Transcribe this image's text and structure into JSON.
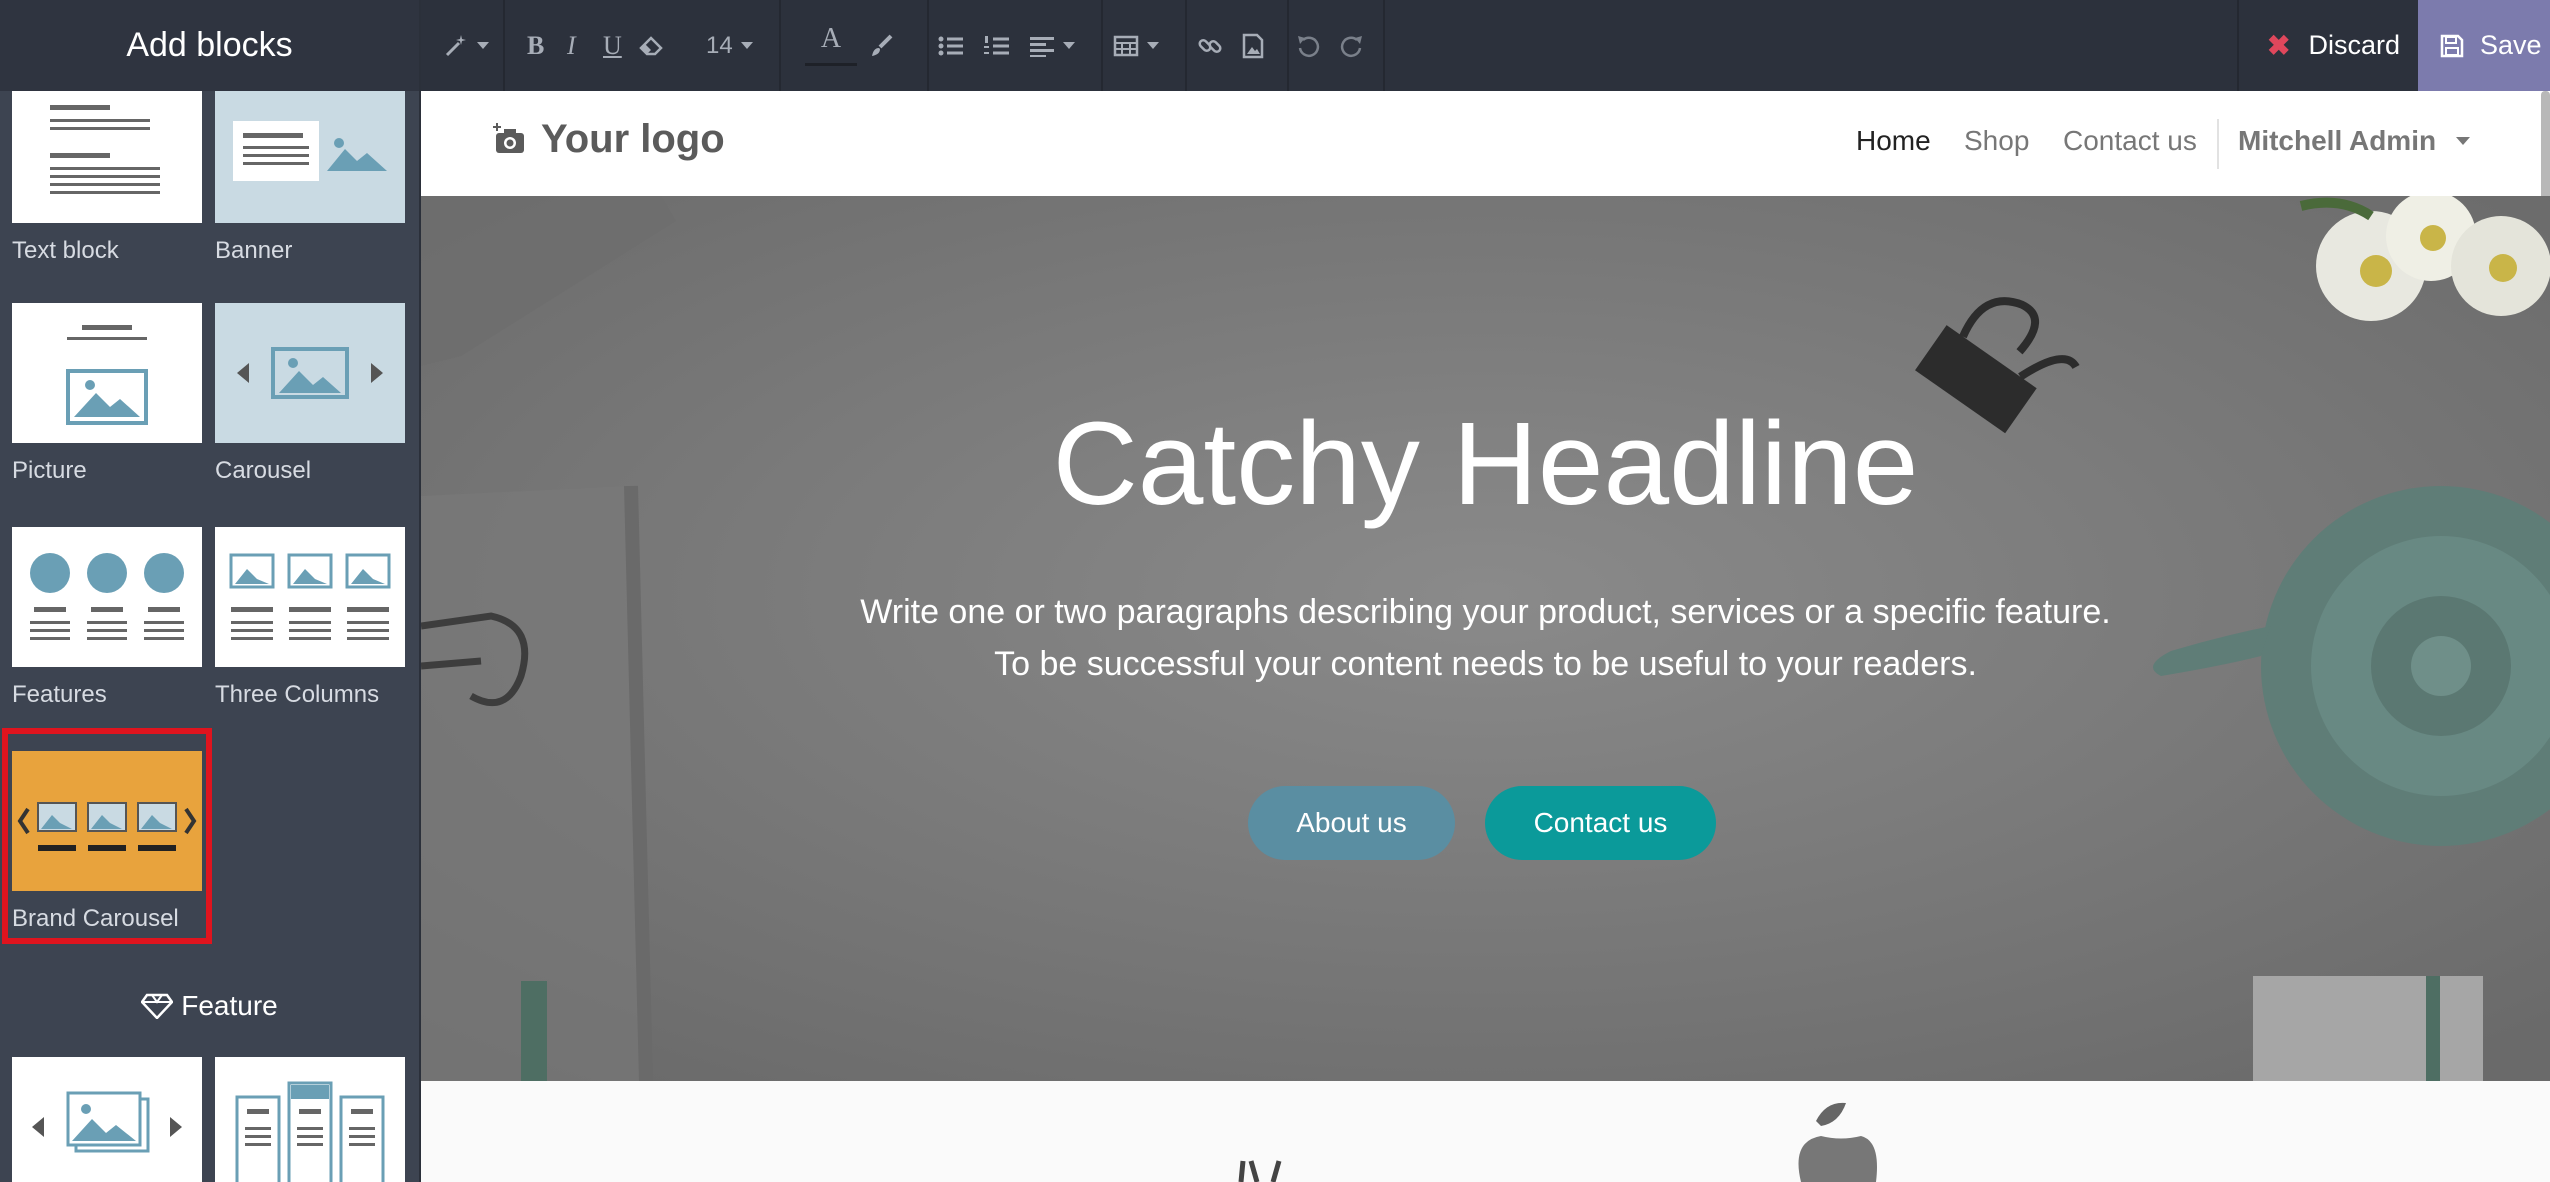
{
  "sidebar": {
    "title": "Add blocks",
    "blocks": [
      {
        "label": "Text block"
      },
      {
        "label": "Banner"
      },
      {
        "label": "Picture"
      },
      {
        "label": "Carousel"
      },
      {
        "label": "Features"
      },
      {
        "label": "Three Columns"
      },
      {
        "label": "Brand Carousel"
      }
    ],
    "section": "Feature",
    "highlight_color": "#e0141e"
  },
  "toolbar": {
    "font_size": "14",
    "discard_label": "Discard",
    "save_label": "Save",
    "icons": [
      "magic-icon",
      "bold-icon",
      "italic-icon",
      "underline-icon",
      "eraser-icon",
      "font-size-select",
      "font-color-icon",
      "paint-brush-icon",
      "bullet-list-icon",
      "numbered-list-icon",
      "align-icon",
      "table-icon",
      "link-icon",
      "image-icon",
      "undo-icon",
      "redo-icon"
    ]
  },
  "site": {
    "logo": "Your logo",
    "nav": {
      "home": "Home",
      "shop": "Shop",
      "contact": "Contact us",
      "user": "Mitchell Admin"
    },
    "hero": {
      "headline": "Catchy Headline",
      "line1": "Write one or two paragraphs describing your product, services or a specific feature.",
      "line2": "To be successful your content needs to be useful to your readers.",
      "btn_about": "About us",
      "btn_contact": "Contact us"
    }
  },
  "colors": {
    "toolbar_bg": "#2c313c",
    "sidebar_bg": "#3d4451",
    "save_bg": "#7c7bad",
    "about_btn": "#5a8ea2",
    "contact_btn": "#0b9a9a",
    "brand_carousel_thumb": "#e8a33d"
  }
}
